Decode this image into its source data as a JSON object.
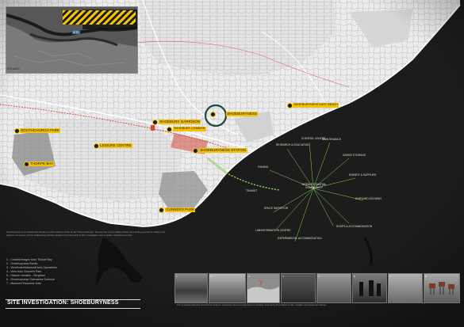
{
  "inset": {
    "tag": "SITE",
    "caption": "ESTUARY"
  },
  "map_labels": [
    {
      "id": "shoeburyness-label",
      "text": "SHOEBURYNESS"
    },
    {
      "id": "southchurch-park",
      "text": "SOUTHCHURCH PARK"
    },
    {
      "id": "thorpe-bay",
      "text": "THORPE BAY"
    },
    {
      "id": "leisure-centre",
      "text": "LEISURE CENTRE"
    },
    {
      "id": "shoeburyness-station",
      "text": "SHOEBURYNESS STATION"
    },
    {
      "id": "east-beach",
      "text": "SHOEBURYNESS EAST BEACH"
    },
    {
      "id": "garrison",
      "text": "SHOEBURY GARRISON"
    },
    {
      "id": "gunners-park",
      "text": "GUNNERS PARK"
    },
    {
      "id": "shoebury-common",
      "text": "SHOEBURY COMMON"
    }
  ],
  "community_hub": "MOBILE COASTAL COMMUNITY",
  "community_nodes": [
    "RESEARCH & EDUCATION",
    "CONTROL CENTRE",
    "MAINTENANCE",
    "CARGO STORAGE",
    "ENERGY & SUPPLIES",
    "SHIPYARD DOCKING",
    "SHOPS & ACCOMMODATION",
    "EXPERIMENTAL ACCOMMODATION",
    "LAB/INFORMATION CENTRE",
    "SPACE SURVEYOR",
    "TRANSIT",
    "FISHING"
  ],
  "legend": [
    "1 - Coastal images from Thorpe Bay",
    "2 - Shoeburyness Ranks",
    "3 - Viewfinder/Maunsell forts Operations",
    "4 - View from Gunners Park",
    "5 - Historic remains - Sergeant",
    "6 - Shoeburyness Submarine Defence",
    "7 - Maunsell Estuarine forts"
  ],
  "title": "SITE INVESTIGATION: SHOEBURYNESS",
  "body_text": "Shoeburyness is a coastal town situated on the northern shore of the Thames Estuary. The site has a long military history as a testing ground for artillery and defence structures, and its relationship with the estuary forms the basis of this investigation into a mobile coastal community.",
  "body_text_2": "The exposed shoreline and historic defence structures inform a proposal for a floating community that adapts to tide, weather and seasonal change.",
  "photos": [
    "1",
    "2",
    "3",
    "4",
    "5",
    "6",
    "7",
    "8"
  ],
  "colors": {
    "accent": "#f3c200",
    "water": "#1e1e1e",
    "land": "#e9e9e9",
    "network": "#8fd05a",
    "rail": "#d24a3a"
  }
}
